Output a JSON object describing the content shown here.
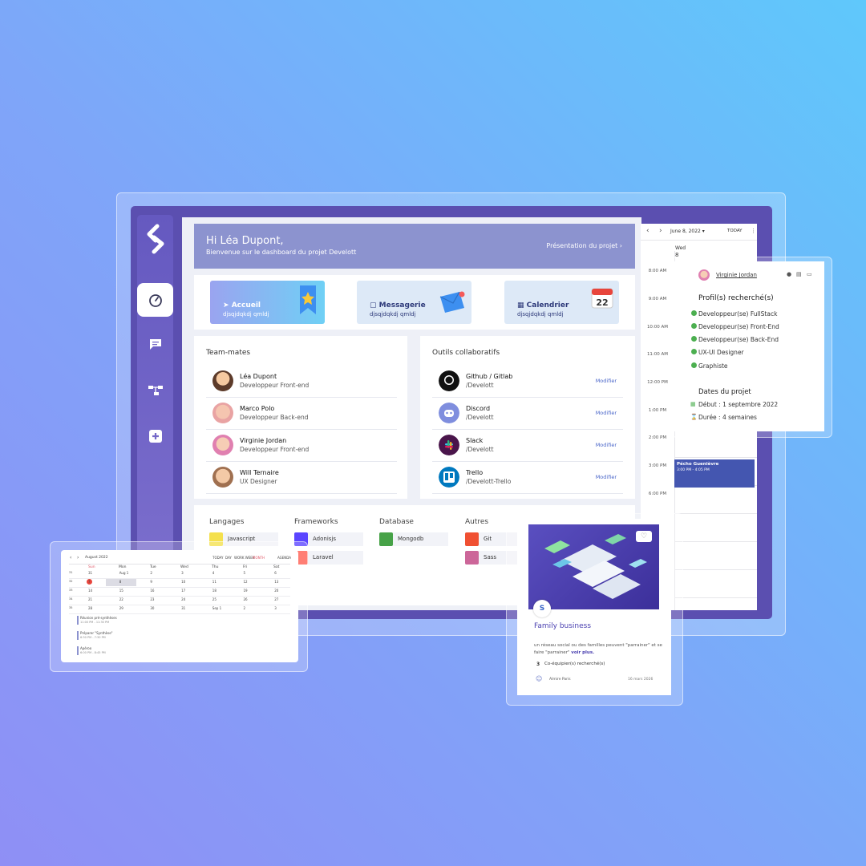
{
  "colors": {
    "accent": "#5b4fb0",
    "hero": "#8c93cf",
    "link": "#4a66c9",
    "check": "#4caf50",
    "event": "#4456b0"
  },
  "sidebar": {
    "items": [
      {
        "icon": "speedometer-icon"
      },
      {
        "icon": "chat-icon"
      },
      {
        "icon": "hierarchy-icon"
      },
      {
        "icon": "plus-icon"
      }
    ]
  },
  "hero": {
    "title": "Hi Léa Dupont,",
    "subtitle": "Bienvenue sur le dashboard du projet Develott",
    "link": "Présentation du projet"
  },
  "cards": [
    {
      "title": "Accueil",
      "sub": "djsqjdqkdj qmldj",
      "icon": "rocket-icon"
    },
    {
      "title": "Messagerie",
      "sub": "djsqjdqkdj qmldj",
      "icon": "message-icon"
    },
    {
      "title": "Calendrier",
      "sub": "djsqjdqkdj qmldj",
      "icon": "calendar-icon"
    }
  ],
  "teammates": {
    "title": "Team-mates",
    "items": [
      {
        "name": "Léa Dupont",
        "role": "Developpeur Front-end"
      },
      {
        "name": "Marco Polo",
        "role": "Developpeur Back-end"
      },
      {
        "name": "Virginie Jordan",
        "role": "Developpeur Front-end"
      },
      {
        "name": "Will Ternaire",
        "role": "UX Designer"
      }
    ]
  },
  "tools": {
    "title": "Outils collaboratifs",
    "action": "Modifier",
    "items": [
      {
        "name": "Github / Gitlab",
        "path": "/Develott",
        "icon": "github-icon"
      },
      {
        "name": "Discord",
        "path": "/Develott",
        "icon": "discord-icon"
      },
      {
        "name": "Slack",
        "path": "/Develott",
        "icon": "slack-icon"
      },
      {
        "name": "Trello",
        "path": "/Develott-Trello",
        "icon": "trello-icon"
      }
    ]
  },
  "tech": {
    "columns": [
      {
        "title": "Langages",
        "items": [
          {
            "label": "Javascript",
            "color": "#f4e04d"
          }
        ]
      },
      {
        "title": "Frameworks",
        "items": [
          {
            "label": "Adonisjs",
            "color": "#5a45ff"
          },
          {
            "label": "Laravel",
            "color": "#ff5a4e"
          }
        ]
      },
      {
        "title": "Database",
        "items": [
          {
            "label": "Mongodb",
            "color": "#47a248"
          }
        ]
      },
      {
        "title": "Autres",
        "items": [
          {
            "label": "Git",
            "color": "#f05032"
          },
          {
            "label": "Sass",
            "color": "#cc6699"
          }
        ]
      }
    ]
  },
  "daycal": {
    "date": "June 8, 2022",
    "today": "TODAY",
    "day_name": "Wed",
    "day_num": "8",
    "times": [
      "8:00 AM",
      "9:00 AM",
      "10:00 AM",
      "11:00 AM",
      "12:00 PM",
      "1:00 PM",
      "2:00 PM",
      "3:00 PM",
      "6:00 PM"
    ],
    "event_title": "Pécho Guenièvre",
    "event_time": "3:00 PM - 4:05 PM"
  },
  "profiles": {
    "user": "Virginie Jordan",
    "title": "Profil(s) recherché(s)",
    "items": [
      "Developpeur(se) FullStack",
      "Developpeur(se) Front-End",
      "Developpeur(se) Back-End",
      "UX-UI Designer",
      "Graphiste"
    ],
    "dates_title": "Dates du projet",
    "start": "Début : 1 septembre 2022",
    "duration": "Durée : 4 semaines"
  },
  "minical": {
    "month": "August 2022",
    "views": [
      "TODAY",
      "DAY",
      "WORK WEEK",
      "MONTH",
      "AGENDA"
    ],
    "days": [
      "Sun",
      "Mon",
      "Tue",
      "Wed",
      "Thu",
      "Fri",
      "Sat"
    ],
    "weeks": [
      {
        "wk": "31",
        "d": [
          "31",
          "Aug 1",
          "2",
          "3",
          "4",
          "5",
          "6"
        ]
      },
      {
        "wk": "32",
        "d": [
          "7",
          "8",
          "9",
          "10",
          "11",
          "12",
          "13"
        ]
      },
      {
        "wk": "33",
        "d": [
          "14",
          "15",
          "16",
          "17",
          "18",
          "19",
          "20"
        ]
      },
      {
        "wk": "34",
        "d": [
          "21",
          "22",
          "23",
          "24",
          "25",
          "26",
          "27"
        ]
      },
      {
        "wk": "35",
        "d": [
          "28",
          "29",
          "30",
          "31",
          "Sep 1",
          "2",
          "3"
        ]
      }
    ],
    "events": [
      {
        "title": "Réunion pré-synthèses",
        "time": "11:00 PM - 11:30 PM"
      },
      {
        "title": "Préparer \"Synthèse\"",
        "time": "6:30 PM - 7:30 PM"
      },
      {
        "title": "Apéroo",
        "time": "6:00 PM - 8:45 PM"
      }
    ]
  },
  "project": {
    "title": "Family business",
    "desc": "un réseau social ou des familles peuvent \"parrainer\" et se faire \"parrainer\"",
    "more": "voir plus.",
    "count": "3",
    "count_label": "Co-équipier(s) recherché(s)",
    "author": "Almire Paris",
    "date": "16 mars 2026"
  }
}
